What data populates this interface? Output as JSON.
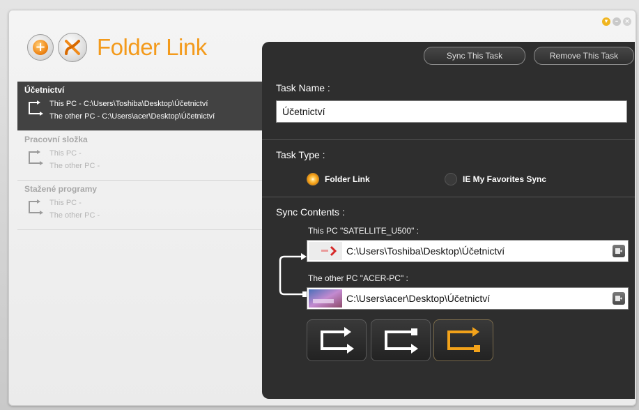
{
  "window": {
    "controls": [
      "arrow-down-icon",
      "minimize-icon",
      "close-icon"
    ],
    "accent_color": "#f39a1b"
  },
  "header": {
    "app_title": "Folder Link",
    "add_icon": "plus-icon",
    "logo_icon": "folder-link-logo-icon"
  },
  "tasks": [
    {
      "name": "Účetnictví",
      "this_pc": "This PC - C:\\Users\\Toshiba\\Desktop\\Účetnictví",
      "other_pc": "The other PC - C:\\Users\\acer\\Desktop\\Účetnictví",
      "selected": true
    },
    {
      "name": "Pracovní složka",
      "this_pc": "This PC -",
      "other_pc": "The other PC -",
      "selected": false
    },
    {
      "name": "Stažené programy",
      "this_pc": "This PC -",
      "other_pc": "The other PC -",
      "selected": false
    }
  ],
  "panel": {
    "sync_button": "Sync This Task",
    "remove_button": "Remove This Task",
    "task_name_label": "Task Name :",
    "task_name_value": "Účetnictví",
    "task_type_label": "Task Type :",
    "task_types": [
      {
        "label": "Folder Link",
        "selected": true
      },
      {
        "label": "IE My Favorites Sync",
        "selected": false
      }
    ],
    "sync_contents_label": "Sync Contents :",
    "this_pc_label": "This PC \"SATELLITE_U500\" :",
    "this_pc_path": "C:\\Users\\Toshiba\\Desktop\\Účetnictví",
    "other_pc_label": "The other PC \"ACER-PC\" :",
    "other_pc_path": "C:\\Users\\acer\\Desktop\\Účetnictví",
    "sync_directions": [
      {
        "icon": "sync-both-icon",
        "active": false
      },
      {
        "icon": "sync-to-this-icon",
        "active": false
      },
      {
        "icon": "sync-to-other-icon",
        "active": true
      }
    ],
    "active_color": "#f2a21a"
  }
}
